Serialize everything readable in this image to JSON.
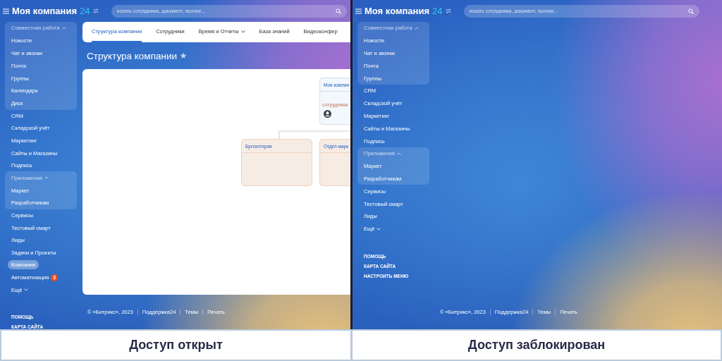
{
  "panels": [
    {
      "logo": "Моя компания",
      "logo_number": "24",
      "search": {
        "placeholder": "искать сотрудника, документ, прочее..."
      },
      "menu": [
        {
          "kind": "group",
          "label": "Совместная работа",
          "expanded": true,
          "children": [
            {
              "label": "Новости",
              "selected": false
            },
            {
              "label": "Чат и звонки",
              "selected": false
            },
            {
              "label": "Почта",
              "selected": false
            },
            {
              "label": "Группы",
              "selected": false
            },
            {
              "label": "Календарь",
              "selected": false
            },
            {
              "label": "Диск",
              "selected": false
            }
          ]
        },
        {
          "kind": "item",
          "label": "CRM",
          "selected": false
        },
        {
          "kind": "item",
          "label": "Складской учёт",
          "selected": false
        },
        {
          "kind": "item",
          "label": "Маркетинг",
          "selected": false
        },
        {
          "kind": "item",
          "label": "Сайты и Магазины",
          "selected": false
        },
        {
          "kind": "item",
          "label": "Подпись",
          "selected": false
        },
        {
          "kind": "group",
          "label": "Приложения",
          "expanded": true,
          "children": [
            {
              "label": "Маркет",
              "selected": false
            },
            {
              "label": "Разработчикам",
              "selected": false
            }
          ]
        },
        {
          "kind": "item",
          "label": "Сервисы",
          "selected": false
        },
        {
          "kind": "item",
          "label": "Тестовый смарт",
          "selected": false
        },
        {
          "kind": "item",
          "label": "Лиды",
          "selected": false
        },
        {
          "kind": "item",
          "label": "Задачи и Проекты",
          "selected": false
        },
        {
          "kind": "item",
          "label": "Компания",
          "selected": true
        },
        {
          "kind": "item",
          "label": "Автоматизация",
          "selected": false,
          "badge": "3"
        },
        {
          "kind": "more",
          "label": "Ещё",
          "selected": false
        }
      ],
      "bottom_links": [
        "ПОМОЩЬ",
        "КАРТА САЙТА"
      ],
      "content": {
        "tabs": [
          {
            "label": "Структура компании",
            "selected": true,
            "dropdown": false
          },
          {
            "label": "Сотрудники",
            "selected": false,
            "dropdown": false
          },
          {
            "label": "Время и Отчеты",
            "selected": false,
            "dropdown": true
          },
          {
            "label": "База знаний",
            "selected": false,
            "dropdown": false
          },
          {
            "label": "Видеоконфер",
            "selected": false,
            "dropdown": false
          }
        ],
        "title": "Структура компании",
        "org_chart": {
          "root": {
            "title": "Моя компан",
            "employees_label": "сотрудники"
          },
          "departments": [
            {
              "title": "Бухгалтерия"
            },
            {
              "title": "Отдел марк"
            }
          ]
        }
      },
      "footer": [
        "© «Битрикс», 2023",
        "Поддержка24",
        "Темы",
        "Печать"
      ],
      "caption": "Доступ открыт"
    },
    {
      "logo": "Моя компания",
      "logo_number": "24",
      "search": {
        "placeholder": "искать сотрудника, документ, прочее..."
      },
      "menu": [
        {
          "kind": "group",
          "label": "Совместная работа",
          "expanded": true,
          "children": [
            {
              "label": "Новости",
              "selected": false
            },
            {
              "label": "Чат и звонки",
              "selected": false
            },
            {
              "label": "Почта",
              "selected": false
            },
            {
              "label": "Группы",
              "selected": false
            }
          ]
        },
        {
          "kind": "item",
          "label": "CRM",
          "selected": false
        },
        {
          "kind": "item",
          "label": "Складской учёт",
          "selected": false
        },
        {
          "kind": "item",
          "label": "Маркетинг",
          "selected": false
        },
        {
          "kind": "item",
          "label": "Сайты и Магазины",
          "selected": false
        },
        {
          "kind": "item",
          "label": "Подпись",
          "selected": false
        },
        {
          "kind": "group",
          "label": "Приложения",
          "expanded": true,
          "children": [
            {
              "label": "Маркет",
              "selected": false
            },
            {
              "label": "Разработчикам",
              "selected": false
            }
          ]
        },
        {
          "kind": "item",
          "label": "Сервисы",
          "selected": false
        },
        {
          "kind": "item",
          "label": "Тестовый смарт",
          "selected": false
        },
        {
          "kind": "item",
          "label": "Лиды",
          "selected": false
        },
        {
          "kind": "more",
          "label": "Ещё",
          "selected": false
        }
      ],
      "bottom_links": [
        "ПОМОЩЬ",
        "КАРТА САЙТА",
        "НАСТРОИТЬ МЕНЮ"
      ],
      "footer": [
        "© «Битрикс», 2023",
        "Поддержка24",
        "Темы",
        "Печать"
      ],
      "caption": "Доступ заблокирован"
    }
  ]
}
